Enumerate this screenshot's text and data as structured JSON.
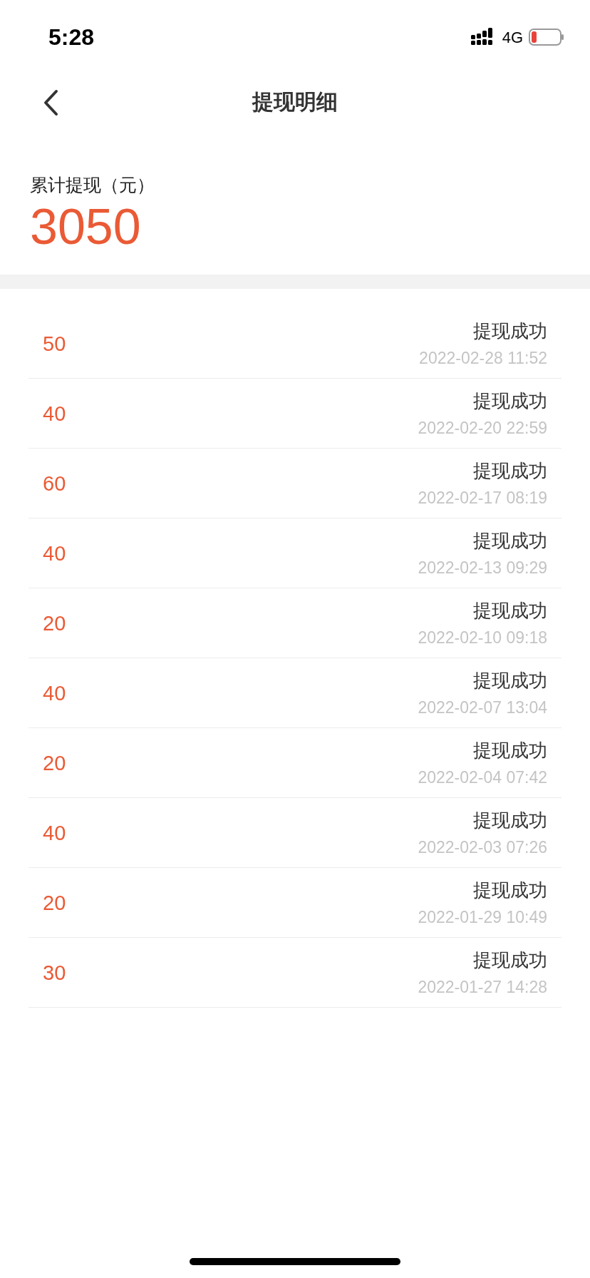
{
  "status_bar": {
    "time": "5:28",
    "network": "4G"
  },
  "header": {
    "title": "提现明细"
  },
  "summary": {
    "label": "累计提现（元）",
    "total": "3050"
  },
  "records": [
    {
      "amount": "50",
      "status": "提现成功",
      "time": "2022-02-28 11:52"
    },
    {
      "amount": "40",
      "status": "提现成功",
      "time": "2022-02-20 22:59"
    },
    {
      "amount": "60",
      "status": "提现成功",
      "time": "2022-02-17 08:19"
    },
    {
      "amount": "40",
      "status": "提现成功",
      "time": "2022-02-13 09:29"
    },
    {
      "amount": "20",
      "status": "提现成功",
      "time": "2022-02-10 09:18"
    },
    {
      "amount": "40",
      "status": "提现成功",
      "time": "2022-02-07 13:04"
    },
    {
      "amount": "20",
      "status": "提现成功",
      "time": "2022-02-04 07:42"
    },
    {
      "amount": "40",
      "status": "提现成功",
      "time": "2022-02-03 07:26"
    },
    {
      "amount": "20",
      "status": "提现成功",
      "time": "2022-01-29 10:49"
    },
    {
      "amount": "30",
      "status": "提现成功",
      "time": "2022-01-27 14:28"
    }
  ]
}
